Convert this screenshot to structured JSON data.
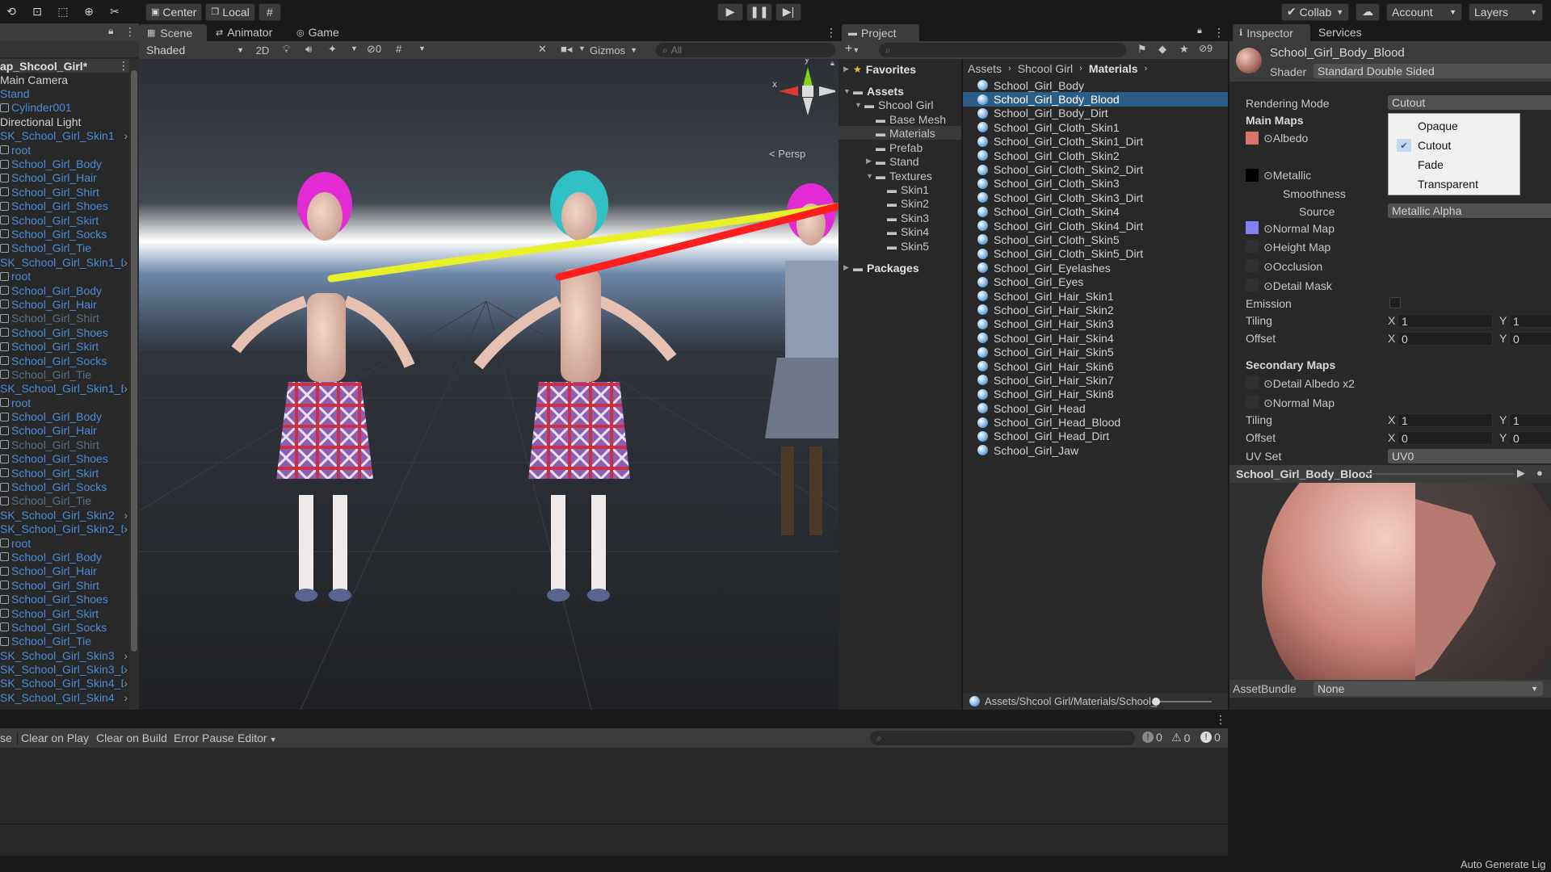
{
  "toolbar": {
    "pivot_center": "Center",
    "pivot_local": "Local",
    "collab": "Collab",
    "account": "Account",
    "layers": "Layers"
  },
  "scene_tabs": {
    "scene": "Scene",
    "animator": "Animator",
    "game": "Game"
  },
  "scene_toolbar": {
    "shading": "Shaded",
    "mode_2d": "2D",
    "hidden_count": "0",
    "gizmos": "Gizmos",
    "search_placeholder": "All"
  },
  "gizmo": {
    "y": "y",
    "x": "x",
    "persp": "Persp"
  },
  "hierarchy": {
    "title": "ap_Shcool_Girl*",
    "items": [
      {
        "label": "Main Camera",
        "style": "w",
        "icon": false,
        "arrow": false
      },
      {
        "label": "Stand",
        "style": "b",
        "icon": false,
        "arrow": false
      },
      {
        "label": "Cylinder001",
        "style": "b",
        "icon": true,
        "arrow": false
      },
      {
        "label": "Directional Light",
        "style": "w",
        "icon": false,
        "arrow": false
      },
      {
        "label": "SK_School_Girl_Skin1",
        "style": "b",
        "icon": false,
        "arrow": true
      },
      {
        "label": "root",
        "style": "b",
        "icon": true,
        "arrow": false
      },
      {
        "label": "School_Girl_Body",
        "style": "b",
        "icon": true,
        "arrow": false
      },
      {
        "label": "School_Girl_Hair",
        "style": "b",
        "icon": true,
        "arrow": false
      },
      {
        "label": "School_Girl_Shirt",
        "style": "b",
        "icon": true,
        "arrow": false
      },
      {
        "label": "School_Girl_Shoes",
        "style": "b",
        "icon": true,
        "arrow": false
      },
      {
        "label": "School_Girl_Skirt",
        "style": "b",
        "icon": true,
        "arrow": false
      },
      {
        "label": "School_Girl_Socks",
        "style": "b",
        "icon": true,
        "arrow": false
      },
      {
        "label": "School_Girl_Tie",
        "style": "b",
        "icon": true,
        "arrow": false
      },
      {
        "label": "SK_School_Girl_Skin1_D",
        "style": "b",
        "icon": false,
        "arrow": true
      },
      {
        "label": "root",
        "style": "b",
        "icon": true,
        "arrow": false
      },
      {
        "label": "School_Girl_Body",
        "style": "b",
        "icon": true,
        "arrow": false
      },
      {
        "label": "School_Girl_Hair",
        "style": "b",
        "icon": true,
        "arrow": false
      },
      {
        "label": "School_Girl_Shirt",
        "style": "d",
        "icon": true,
        "arrow": false
      },
      {
        "label": "School_Girl_Shoes",
        "style": "b",
        "icon": true,
        "arrow": false
      },
      {
        "label": "School_Girl_Skirt",
        "style": "b",
        "icon": true,
        "arrow": false
      },
      {
        "label": "School_Girl_Socks",
        "style": "b",
        "icon": true,
        "arrow": false
      },
      {
        "label": "School_Girl_Tie",
        "style": "d",
        "icon": true,
        "arrow": false
      },
      {
        "label": "SK_School_Girl_Skin1_E",
        "style": "b",
        "icon": false,
        "arrow": true
      },
      {
        "label": "root",
        "style": "b",
        "icon": true,
        "arrow": false
      },
      {
        "label": "School_Girl_Body",
        "style": "b",
        "icon": true,
        "arrow": false
      },
      {
        "label": "School_Girl_Hair",
        "style": "b",
        "icon": true,
        "arrow": false
      },
      {
        "label": "School_Girl_Shirt",
        "style": "d",
        "icon": true,
        "arrow": false
      },
      {
        "label": "School_Girl_Shoes",
        "style": "b",
        "icon": true,
        "arrow": false
      },
      {
        "label": "School_Girl_Skirt",
        "style": "b",
        "icon": true,
        "arrow": false
      },
      {
        "label": "School_Girl_Socks",
        "style": "b",
        "icon": true,
        "arrow": false
      },
      {
        "label": "School_Girl_Tie",
        "style": "d",
        "icon": true,
        "arrow": false
      },
      {
        "label": "SK_School_Girl_Skin2",
        "style": "b",
        "icon": false,
        "arrow": true
      },
      {
        "label": "SK_School_Girl_Skin2_D",
        "style": "b",
        "icon": false,
        "arrow": true
      },
      {
        "label": "root",
        "style": "b",
        "icon": true,
        "arrow": false
      },
      {
        "label": "School_Girl_Body",
        "style": "b",
        "icon": true,
        "arrow": false
      },
      {
        "label": "School_Girl_Hair",
        "style": "b",
        "icon": true,
        "arrow": false
      },
      {
        "label": "School_Girl_Shirt",
        "style": "b",
        "icon": true,
        "arrow": false
      },
      {
        "label": "School_Girl_Shoes",
        "style": "b",
        "icon": true,
        "arrow": false
      },
      {
        "label": "School_Girl_Skirt",
        "style": "b",
        "icon": true,
        "arrow": false
      },
      {
        "label": "School_Girl_Socks",
        "style": "b",
        "icon": true,
        "arrow": false
      },
      {
        "label": "School_Girl_Tie",
        "style": "b",
        "icon": true,
        "arrow": false
      },
      {
        "label": "SK_School_Girl_Skin3",
        "style": "b",
        "icon": false,
        "arrow": true
      },
      {
        "label": "SK_School_Girl_Skin3_D",
        "style": "b",
        "icon": false,
        "arrow": true
      },
      {
        "label": "SK_School_Girl_Skin4_D",
        "style": "b",
        "icon": false,
        "arrow": true
      },
      {
        "label": "SK_School_Girl_Skin4",
        "style": "b",
        "icon": false,
        "arrow": true
      }
    ]
  },
  "project": {
    "tab": "Project",
    "tree": [
      {
        "label": "Favorites",
        "bold": true
      },
      {
        "label": "Assets",
        "bold": true
      },
      {
        "label": "Shcool Girl",
        "bold": false
      },
      {
        "label": "Base Mesh",
        "bold": false
      },
      {
        "label": "Materials",
        "bold": false
      },
      {
        "label": "Prefab",
        "bold": false
      },
      {
        "label": "Stand",
        "bold": false
      },
      {
        "label": "Textures",
        "bold": false
      },
      {
        "label": "Skin1",
        "bold": false
      },
      {
        "label": "Skin2",
        "bold": false
      },
      {
        "label": "Skin3",
        "bold": false
      },
      {
        "label": "Skin4",
        "bold": false
      },
      {
        "label": "Skin5",
        "bold": false
      },
      {
        "label": "Packages",
        "bold": true
      }
    ],
    "breadcrumb": [
      "Assets",
      "Shcool Girl",
      "Materials"
    ],
    "assets": [
      "School_Girl_Body",
      "School_Girl_Body_Blood",
      "School_Girl_Body_Dirt",
      "School_Girl_Cloth_Skin1",
      "School_Girl_Cloth_Skin1_Dirt",
      "School_Girl_Cloth_Skin2",
      "School_Girl_Cloth_Skin2_Dirt",
      "School_Girl_Cloth_Skin3",
      "School_Girl_Cloth_Skin3_Dirt",
      "School_Girl_Cloth_Skin4",
      "School_Girl_Cloth_Skin4_Dirt",
      "School_Girl_Cloth_Skin5",
      "School_Girl_Cloth_Skin5_Dirt",
      "School_Girl_Eyelashes",
      "School_Girl_Eyes",
      "School_Girl_Hair_Skin1",
      "School_Girl_Hair_Skin2",
      "School_Girl_Hair_Skin3",
      "School_Girl_Hair_Skin4",
      "School_Girl_Hair_Skin5",
      "School_Girl_Hair_Skin6",
      "School_Girl_Hair_Skin7",
      "School_Girl_Hair_Skin8",
      "School_Girl_Head",
      "School_Girl_Head_Blood",
      "School_Girl_Head_Dirt",
      "School_Girl_Jaw"
    ],
    "selected_index": 1,
    "path": "Assets/Shcool Girl/Materials/School_",
    "hidden_count": "9"
  },
  "inspector": {
    "tab": "Inspector",
    "services_tab": "Services",
    "material_name": "School_Girl_Body_Blood",
    "shader_label": "Shader",
    "shader_value": "Standard Double Sided",
    "rendering_mode_label": "Rendering Mode",
    "rendering_mode_value": "Cutout",
    "main_maps": "Main Maps",
    "albedo": "Albedo",
    "metallic": "Metallic",
    "smoothness": "Smoothness",
    "source": "Source",
    "source_value": "Metallic Alpha",
    "normal_map": "Normal Map",
    "height_map": "Height Map",
    "occlusion": "Occlusion",
    "detail_mask": "Detail Mask",
    "emission": "Emission",
    "tiling": "Tiling",
    "offset": "Offset",
    "tiling_x": "1",
    "tiling_y": "1",
    "offset_x": "0",
    "offset_y": "0",
    "secondary_maps": "Secondary Maps",
    "detail_albedo": "Detail Albedo x2",
    "normal_map2": "Normal Map",
    "tiling2_x": "1",
    "tiling2_y": "1",
    "offset2_x": "0",
    "offset2_y": "0",
    "uv_set": "UV Set",
    "uv_set_value": "UV0",
    "x_label": "X",
    "y_label": "Y",
    "preview_title": "School_Girl_Body_Blood",
    "assetbundle_label": "AssetBundle",
    "assetbundle_value": "None",
    "auto_generate": "Auto Generate Lig"
  },
  "rendering_dropdown": {
    "options": [
      "Opaque",
      "Cutout",
      "Fade",
      "Transparent"
    ],
    "selected": "Cutout"
  },
  "console": {
    "clear_partial": "se",
    "clear_on_play": "Clear on Play",
    "clear_on_build": "Clear on Build",
    "error_pause": "Error Pause",
    "editor": "Editor",
    "log_count": "0",
    "warn_count": "0",
    "error_count": "0"
  },
  "colors": {
    "accent": "#2c5d87",
    "selection": "#2c5d87",
    "link_blue": "#4a8cd8",
    "annotation_red": "#ff1e1e",
    "annotation_yellow": "#e8f02a"
  }
}
